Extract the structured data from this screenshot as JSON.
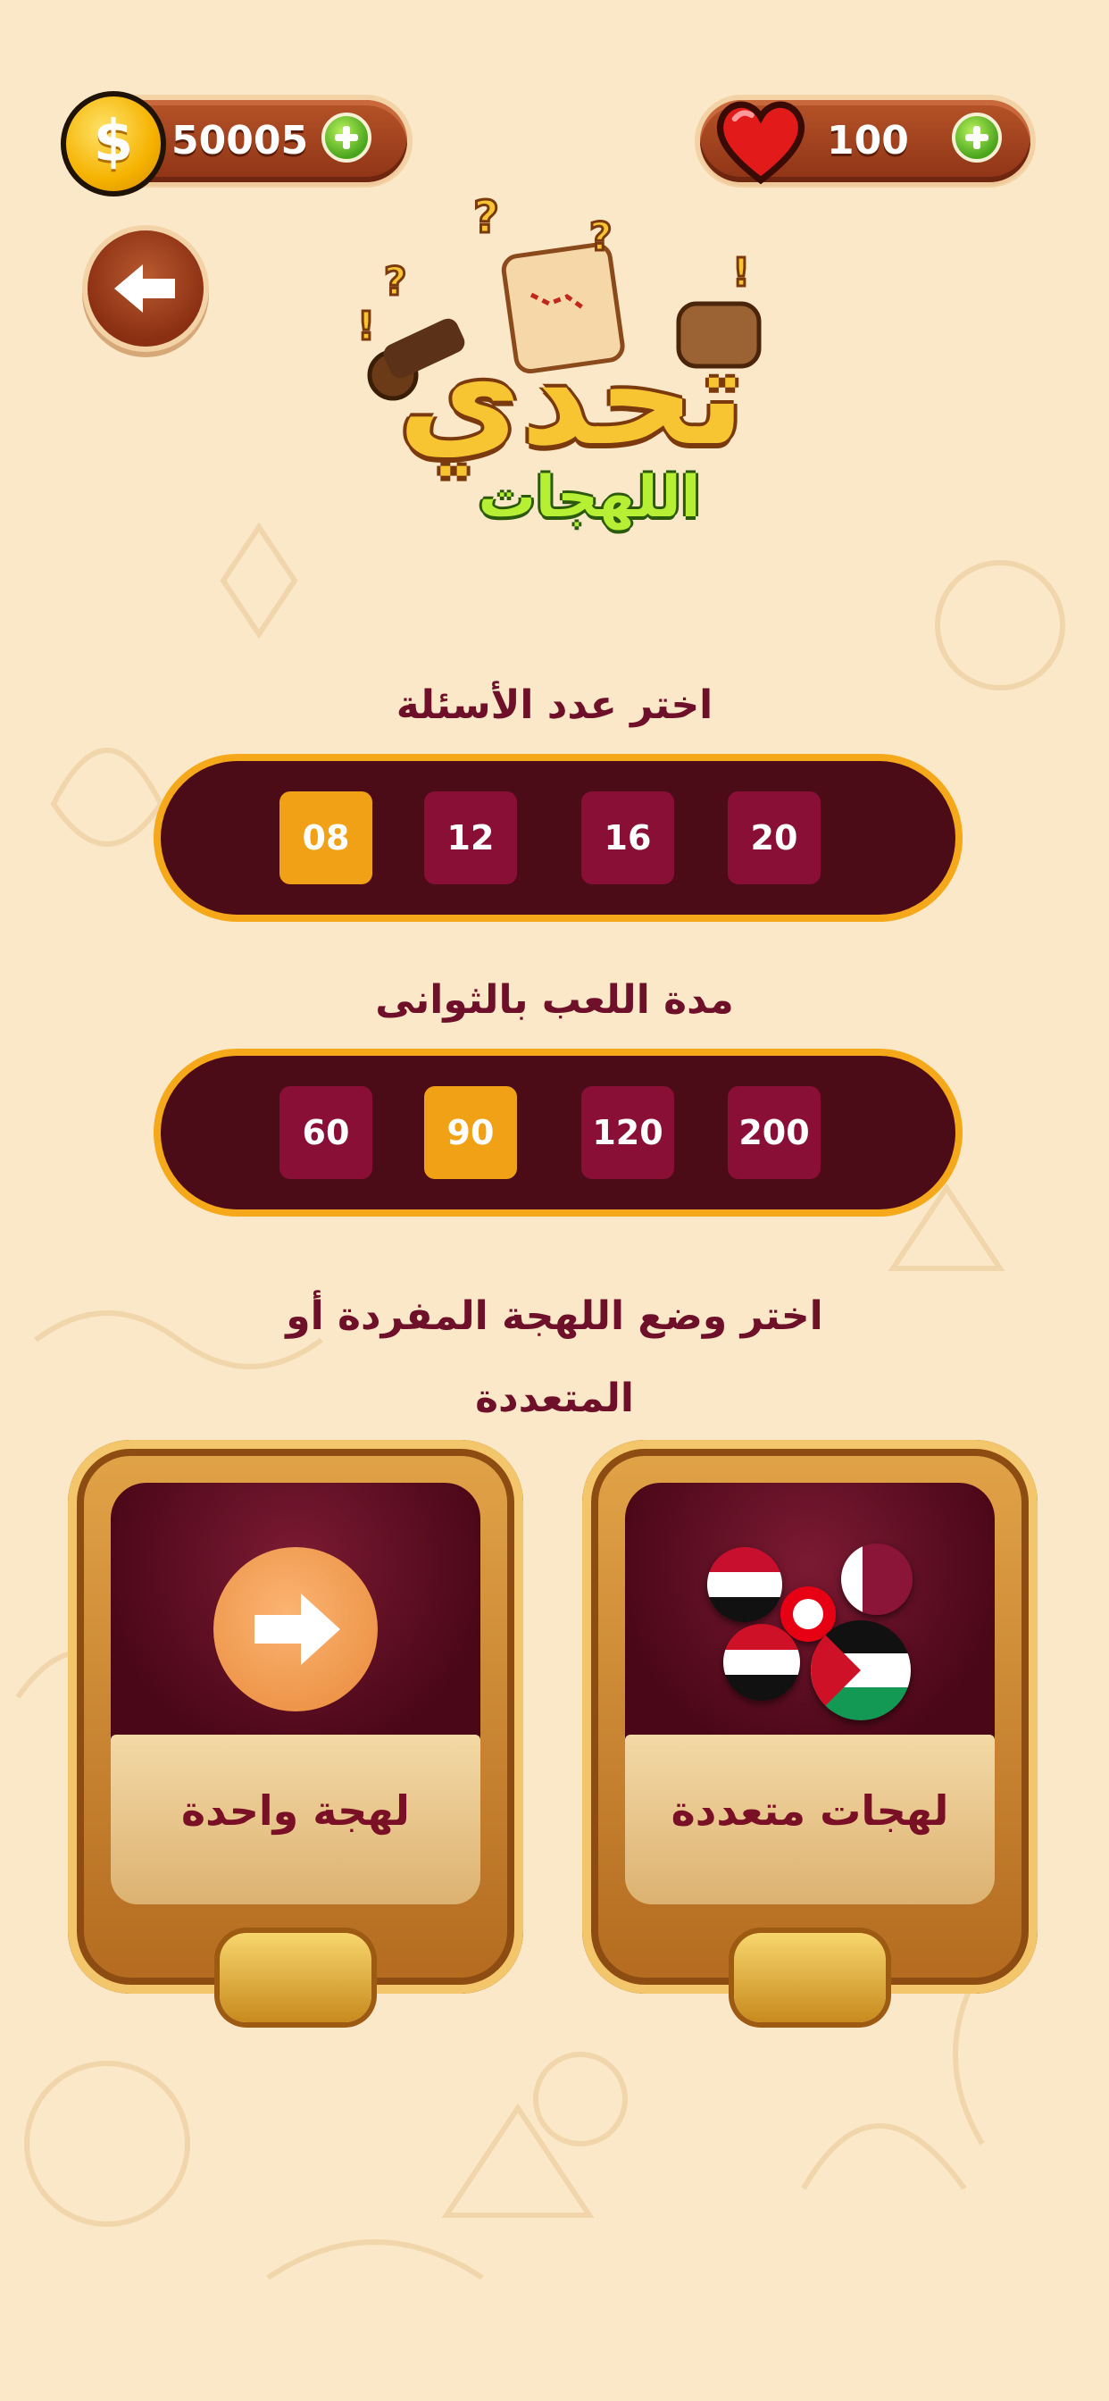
{
  "header": {
    "coins": "50005",
    "lives": "100"
  },
  "logo": {
    "title": "تحدي",
    "subtitle": "اللهجات"
  },
  "questions": {
    "title": "اختر عدد الأسئلة",
    "options": [
      "08",
      "12",
      "16",
      "20"
    ],
    "selected": "08"
  },
  "duration": {
    "title": "مدة اللعب بالثوانى",
    "options": [
      "60",
      "90",
      "120",
      "200"
    ],
    "selected": "90"
  },
  "mode": {
    "title_line1": "اختر وضع اللهجة المفردة أو",
    "title_line2": "المتعددة",
    "single_label": "لهجة واحدة",
    "multi_label": "لهجات متعددة"
  },
  "colors": {
    "background": "#fbe8c8",
    "pill_bg": "#4b0b17",
    "option_bg": "#8a0f36",
    "option_selected": "#f0a115",
    "title_color": "#6e1029"
  },
  "icons": [
    "coin-icon",
    "heart-icon",
    "plus-icon",
    "back-arrow-icon",
    "forward-arrow-icon",
    "flag-icons"
  ]
}
